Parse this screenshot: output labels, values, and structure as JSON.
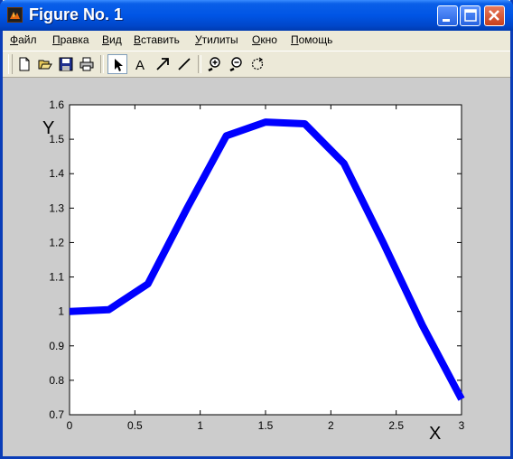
{
  "window": {
    "title": "Figure No. 1",
    "controls": [
      "minimize-icon",
      "maximize-icon",
      "close-icon"
    ]
  },
  "menu": {
    "file": {
      "ul": "Ф",
      "rest": "айл"
    },
    "edit": {
      "ul": "П",
      "rest": "равка"
    },
    "view": {
      "ul": "В",
      "rest": "ид"
    },
    "insert": {
      "ul": "В",
      "rest": "ставить"
    },
    "tools": {
      "ul": "У",
      "rest": "тилиты"
    },
    "window": {
      "ul": "О",
      "rest": "кно"
    },
    "help": {
      "ul": "П",
      "rest": "омощь"
    }
  },
  "toolbar": {
    "icons": [
      "new-icon",
      "open-icon",
      "save-icon",
      "print-icon",
      "select-arrow-icon",
      "text-icon",
      "arrow-icon",
      "line-icon",
      "zoom-in-icon",
      "zoom-out-icon",
      "rotate-icon"
    ],
    "text_tool_label": "A"
  },
  "colors": {
    "line": "#0000FF",
    "figure_bg": "#CCCCCC",
    "axes_bg": "#FFFFFF"
  },
  "chart_data": {
    "type": "line",
    "xlabel": "X",
    "ylabel": "Y",
    "xlim": [
      0,
      3
    ],
    "ylim": [
      0.7,
      1.6
    ],
    "xticks": [
      0,
      0.5,
      1,
      1.5,
      2,
      2.5,
      3
    ],
    "xtick_labels": [
      "0",
      "0.5",
      "1",
      "1.5",
      "2",
      "2.5",
      "3"
    ],
    "yticks": [
      0.7,
      0.8,
      0.9,
      1.0,
      1.1,
      1.2,
      1.3,
      1.4,
      1.5,
      1.6
    ],
    "ytick_labels": [
      "0.7",
      "0.8",
      "0.9",
      "1",
      "1.1",
      "1.2",
      "1.3",
      "1.4",
      "1.5",
      "1.6"
    ],
    "grid": false,
    "series": [
      {
        "color": "#0000FF",
        "x": [
          0,
          0.3,
          0.6,
          0.9,
          1.2,
          1.5,
          1.8,
          2.1,
          2.4,
          2.7,
          3.0
        ],
        "y": [
          1.0,
          1.005,
          1.08,
          1.3,
          1.51,
          1.55,
          1.545,
          1.43,
          1.2,
          0.96,
          0.745
        ]
      }
    ]
  }
}
